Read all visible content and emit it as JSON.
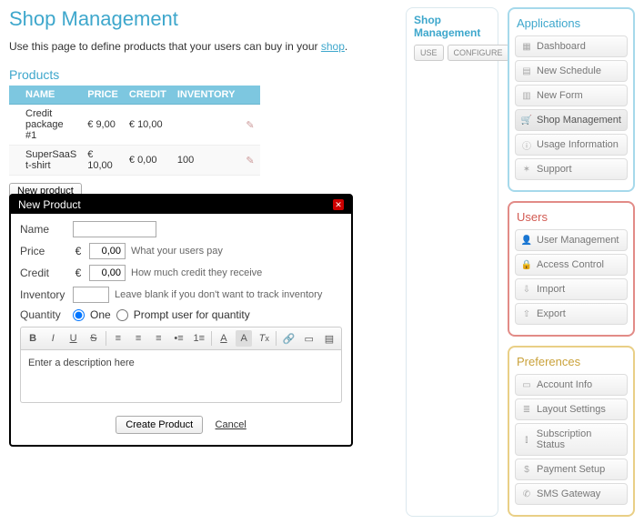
{
  "page": {
    "title": "Shop Management",
    "intro_prefix": "Use this page to define products that your users can buy in your ",
    "intro_link": "shop",
    "intro_suffix": "."
  },
  "products": {
    "heading": "Products",
    "columns": {
      "name": "Name",
      "price": "Price",
      "credit": "Credit",
      "inventory": "Inventory"
    },
    "rows": [
      {
        "name": "Credit package #1",
        "price": "€  9,00",
        "credit": "€ 10,00",
        "inventory": ""
      },
      {
        "name": "SuperSaaS t-shirt",
        "price": "€ 10,00",
        "credit": "€  0,00",
        "inventory": "100"
      }
    ],
    "new_btn": "New product"
  },
  "modal": {
    "title": "New Product",
    "labels": {
      "name": "Name",
      "price": "Price",
      "credit": "Credit",
      "inventory": "Inventory",
      "quantity": "Quantity"
    },
    "currency": "€",
    "values": {
      "price": "0,00",
      "credit": "0,00",
      "inventory": "",
      "name": ""
    },
    "hints": {
      "price": "What your users pay",
      "credit": "How much credit they receive",
      "inventory": "Leave blank if you don't want to track inventory"
    },
    "qty": {
      "one": "One",
      "prompt": "Prompt user for quantity"
    },
    "desc_placeholder": "Enter a description here",
    "create": "Create Product",
    "cancel": "Cancel"
  },
  "shopbox": {
    "title": "Shop Management",
    "use": "USE",
    "configure": "CONFIGURE"
  },
  "sidebar": {
    "apps": {
      "title": "Applications",
      "items": [
        {
          "icon": "grid",
          "label": "Dashboard"
        },
        {
          "icon": "calendar",
          "label": "New Schedule"
        },
        {
          "icon": "form",
          "label": "New Form"
        },
        {
          "icon": "cart",
          "label": "Shop Management",
          "active": true
        },
        {
          "icon": "info",
          "label": "Usage Information"
        },
        {
          "icon": "help",
          "label": "Support"
        }
      ]
    },
    "users": {
      "title": "Users",
      "items": [
        {
          "icon": "user",
          "label": "User Management"
        },
        {
          "icon": "lock",
          "label": "Access Control"
        },
        {
          "icon": "import",
          "label": "Import"
        },
        {
          "icon": "export",
          "label": "Export"
        }
      ]
    },
    "prefs": {
      "title": "Preferences",
      "items": [
        {
          "icon": "card",
          "label": "Account Info"
        },
        {
          "icon": "layout",
          "label": "Layout Settings"
        },
        {
          "icon": "chart",
          "label": "Subscription Status"
        },
        {
          "icon": "money",
          "label": "Payment Setup"
        },
        {
          "icon": "phone",
          "label": "SMS Gateway"
        }
      ]
    }
  }
}
